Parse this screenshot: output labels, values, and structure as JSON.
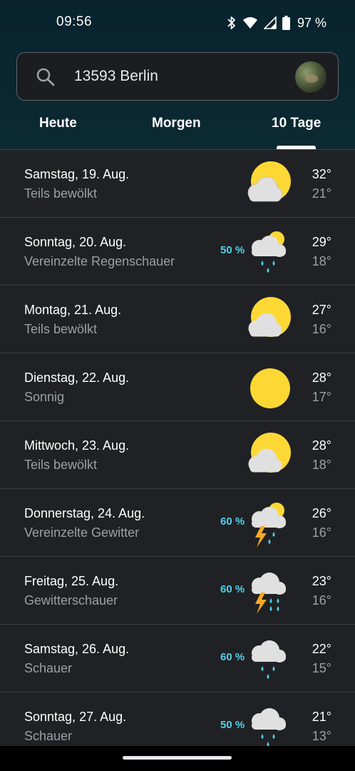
{
  "status": {
    "time": "09:56",
    "battery": "97 %"
  },
  "search": {
    "query": "13593 Berlin"
  },
  "tabs": [
    {
      "label": "Heute"
    },
    {
      "label": "Morgen"
    },
    {
      "label": "10 Tage",
      "selected": true
    }
  ],
  "days": [
    {
      "date": "Samstag, 19. Aug.",
      "condition": "Teils bewölkt",
      "precip": "",
      "high": "32°",
      "low": "21°",
      "icon": "partly-cloudy-icon"
    },
    {
      "date": "Sonntag, 20. Aug.",
      "condition": "Vereinzelte Regenschauer",
      "precip": "50 %",
      "high": "29°",
      "low": "18°",
      "icon": "scattered-showers-icon"
    },
    {
      "date": "Montag, 21. Aug.",
      "condition": "Teils bewölkt",
      "precip": "",
      "high": "27°",
      "low": "16°",
      "icon": "partly-cloudy-icon"
    },
    {
      "date": "Dienstag, 22. Aug.",
      "condition": "Sonnig",
      "precip": "",
      "high": "28°",
      "low": "17°",
      "icon": "sunny-icon"
    },
    {
      "date": "Mittwoch, 23. Aug.",
      "condition": "Teils bewölkt",
      "precip": "",
      "high": "28°",
      "low": "18°",
      "icon": "partly-cloudy-icon"
    },
    {
      "date": "Donnerstag, 24. Aug.",
      "condition": "Vereinzelte Gewitter",
      "precip": "60 %",
      "high": "26°",
      "low": "16°",
      "icon": "scattered-thunderstorms-icon"
    },
    {
      "date": "Freitag, 25. Aug.",
      "condition": "Gewitterschauer",
      "precip": "60 %",
      "high": "23°",
      "low": "16°",
      "icon": "thunder-showers-icon"
    },
    {
      "date": "Samstag, 26. Aug.",
      "condition": "Schauer",
      "precip": "60 %",
      "high": "22°",
      "low": "15°",
      "icon": "showers-icon"
    },
    {
      "date": "Sonntag, 27. Aug.",
      "condition": "Schauer",
      "precip": "50 %",
      "high": "21°",
      "low": "13°",
      "icon": "showers-icon"
    }
  ],
  "colors": {
    "background": "#202124",
    "header": "#0c2a33",
    "precip": "#4fd1e8",
    "sun": "#fdd835",
    "cloud": "#e0e0e0",
    "rain": "#4fd1e8",
    "lightning": "#f9a825"
  }
}
